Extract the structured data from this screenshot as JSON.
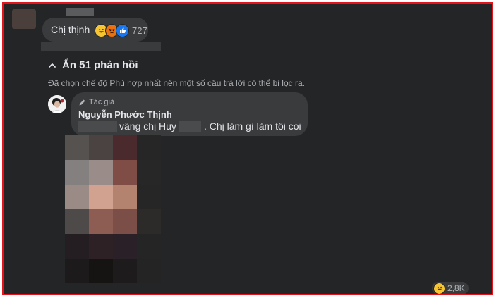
{
  "top_comment": {
    "text": "Chị thịnh",
    "reaction_icons": [
      "haha-icon",
      "angry-icon",
      "like-icon"
    ],
    "reaction_count": "727"
  },
  "replies_toggle": {
    "label": "Ẩn 51 phản hồi"
  },
  "filter_note": "Đã chọn chế độ Phù hợp nhất nên một số câu trả lời có thể bị lọc ra.",
  "reply": {
    "author_badge": "Tác giả",
    "author_name": "Nguyễn Phước Thịnh",
    "text_part1": "vâng chị Huy",
    "text_part2": ". Chị làm gì làm tôi coi"
  },
  "bottom_reaction": {
    "icon": "haha-icon",
    "count": "2,8K"
  },
  "colors": {
    "background": "#242526",
    "bubble": "#3a3b3c",
    "text": "#e4e6eb",
    "secondary_text": "#b0b3b8",
    "like_blue": "#1877f2",
    "border_red": "#e3141b"
  }
}
